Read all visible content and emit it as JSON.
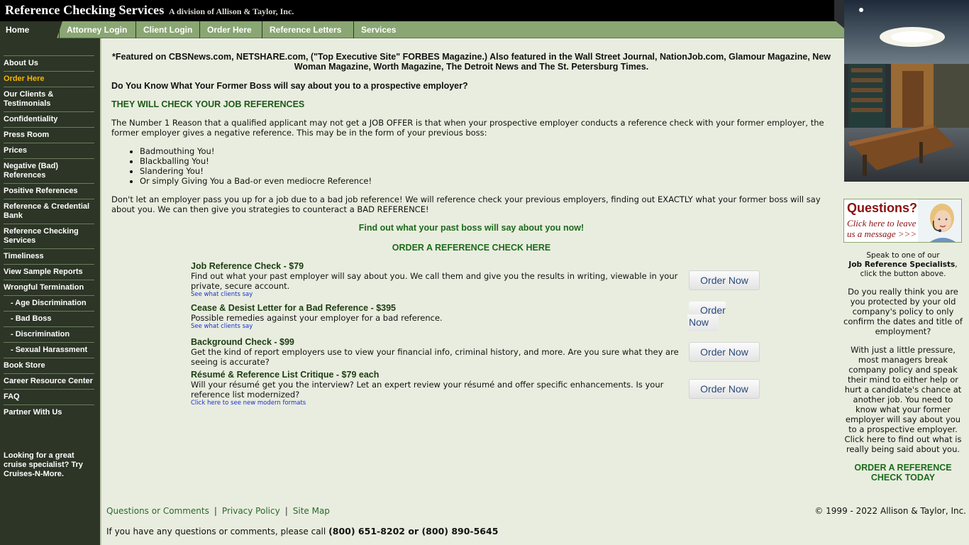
{
  "header": {
    "title": "Reference Checking Services",
    "tagline": "A division of Allison & Taylor, Inc."
  },
  "nav": {
    "tabs": [
      "Home",
      "Attorney Login",
      "Client Login",
      "Order Here",
      "Reference Letters",
      "Services"
    ]
  },
  "sidebar": {
    "items": [
      "About Us",
      "Order Here",
      "Our Clients & Testimonials",
      "Confidentiality",
      "Press Room",
      "Prices",
      "Negative (Bad) References",
      "Positive References",
      "Reference & Credential Bank",
      "Reference Checking Services",
      "Timeliness",
      "View Sample Reports",
      "Wrongful Termination",
      "- Age Discrimination",
      "- Bad Boss",
      "- Discrimination",
      "- Sexual Harassment",
      "Book Store",
      "Career Resource Center",
      "FAQ",
      "Partner With Us"
    ],
    "promo": "Looking for a great cruise specialist? Try Cruises-N-More."
  },
  "main": {
    "featured": "*Featured on CBSNews.com, NETSHARE.com, (\"Top Executive Site\" FORBES Magazine.) Also featured in the Wall Street Journal, NationJob.com, Glamour Magazine, New Woman Magazine, Worth Magazine, The Detroit News and The St. Petersburg Times.",
    "question": "Do You Know What Your Former Boss will say about you to a prospective employer?",
    "green_heading": "THEY WILL CHECK YOUR JOB REFERENCES",
    "para1": "The Number 1 Reason that a qualified applicant may not get a JOB OFFER is that when your prospective employer conducts a reference check with your former employer, the former employer gives a negative reference. This may be in the form of your previous boss:",
    "bullets": [
      "Badmouthing You!",
      "Blackballing You!",
      "Slandering You!",
      "Or simply Giving You a Bad-or even mediocre Reference!"
    ],
    "para2": "Don't let an employer pass you up for a job due to a bad job reference! We will reference check your previous employers, finding out EXACTLY what your former boss will say about you. We can then give you strategies to counteract a BAD REFERENCE!",
    "find_out": "Find out what your past boss will say about you now!",
    "order_link": "ORDER A REFERENCE CHECK HERE",
    "services": [
      {
        "title": "Job Reference Check - $79",
        "desc": "Find out what your past employer will say about you. We call them and give you the results in writing, viewable in your private, secure account.",
        "link": "See what clients say",
        "button": "Order Now"
      },
      {
        "title": "Cease & Desist Letter for a Bad Reference - $395",
        "desc": "Possible remedies against your employer for a bad reference.",
        "link": "See what clients say",
        "button_line1": "Order",
        "button_line2": "Now"
      },
      {
        "title": "Background Check - $99",
        "desc": "Get the kind of report employers use to view your financial info, criminal history, and more. Are you sure what they are seeing is accurate?",
        "button": "Order Now"
      },
      {
        "title": "Résumé & Reference List Critique - $79 each",
        "desc": "Will your résumé get you the interview? Let an expert review your résumé and offer specific enhancements. Is your reference list modernized?",
        "link": "Click here to see new modern formats",
        "button": "Order Now"
      }
    ]
  },
  "right": {
    "questions_title": "Questions?",
    "questions_sub": "Click here to leave us a message >>>",
    "speak_pre": "Speak to one of our",
    "speak_bold": "Job Reference Specialists",
    "speak_post": ", click the button above.",
    "para1": "Do you really think you are you protected by your old company's policy to only confirm the dates and title of employment?",
    "para2": "With just a little pressure, most managers break company policy and speak their mind to either help or hurt a candidate's chance at another job. You need to know what your former employer will say about you to a prospective employer. Click here to find out what is really being said about you.",
    "cta": "ORDER A REFERENCE CHECK TODAY"
  },
  "footer": {
    "links": [
      "Questions or Comments",
      "Privacy Policy",
      "Site Map"
    ],
    "copyright": "© 1999 - 2022 Allison & Taylor, Inc.",
    "call_prefix": "If you have any questions or comments, please call",
    "phones": "(800) 651-8202 or (800) 890-5645"
  },
  "colors": {
    "nav_green": "#8aa673",
    "sidebar_dark": "#2c3526",
    "active_orange": "#f6b500",
    "heading_green": "#1c6a1c",
    "background": "#e9eddf"
  }
}
